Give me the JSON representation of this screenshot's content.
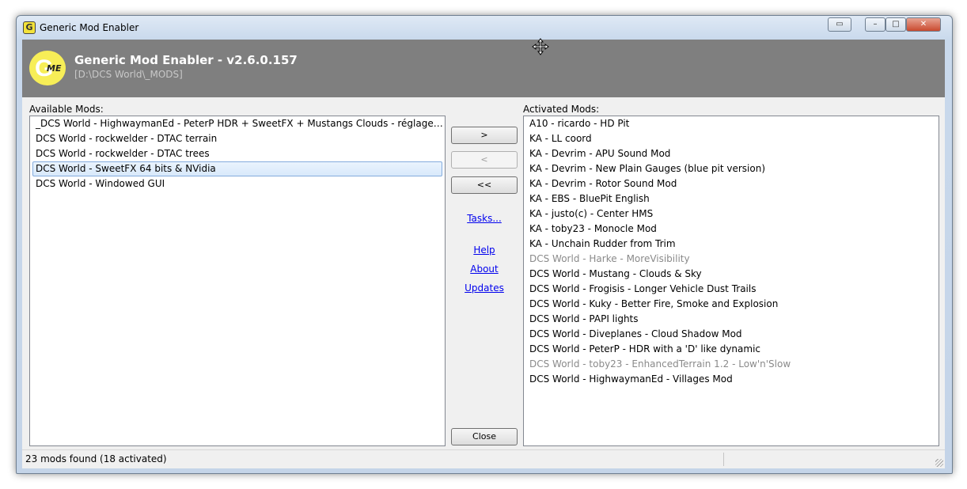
{
  "window": {
    "title": "Generic Mod Enabler",
    "icon_letter": "G",
    "caption_buttons": {
      "extra": "▭",
      "minimize": "–",
      "maximize": "□",
      "close": "✕"
    }
  },
  "banner": {
    "logo_letter": "G",
    "logo_me": "ME",
    "title": "Generic Mod Enabler - v2.6.0.157",
    "path": "[D:\\DCS World\\_MODS]"
  },
  "available": {
    "label": "Available Mods:",
    "items": [
      "_DCS World - HighwaymanEd - PeterP HDR + SweetFX + Mustangs Clouds - réglages SweetFX ...",
      "DCS World - rockwelder - DTAC terrain",
      "DCS World - rockwelder - DTAC trees",
      "DCS World - SweetFX 64 bits & NVidia",
      "DCS World - Windowed GUI"
    ]
  },
  "activated": {
    "label": "Activated Mods:",
    "items": [
      "A10 - ricardo - HD Pit",
      "KA - LL coord",
      "KA - Devrim - APU Sound Mod",
      "KA - Devrim - New Plain Gauges (blue pit version)",
      "KA - Devrim - Rotor Sound Mod",
      "KA - EBS - BluePit English",
      "KA - justo(c) - Center HMS",
      "KA - toby23 - Monocle Mod",
      "KA - Unchain Rudder from Trim",
      "DCS World - Harke - MoreVisibility",
      "DCS World - Mustang - Clouds & Sky",
      "DCS World - Frogisis - Longer Vehicle Dust Trails",
      "DCS World - Kuky - Better Fire, Smoke and Explosion",
      "DCS World - PAPI lights",
      "DCS World - Diveplanes - Cloud Shadow Mod",
      "DCS World - PeterP - HDR with a 'D' like dynamic",
      "DCS World - toby23 - EnhancedTerrain 1.2 - Low'n'Slow",
      "DCS World - HighwaymanEd - Villages Mod"
    ]
  },
  "buttons": {
    "activate": ">",
    "deactivate": "<",
    "deactivate_all": "<<",
    "close": "Close"
  },
  "links": {
    "tasks": "Tasks...",
    "help": "Help",
    "about": "About",
    "updates": "Updates"
  },
  "status": {
    "text": "23 mods found (18 activated)"
  }
}
